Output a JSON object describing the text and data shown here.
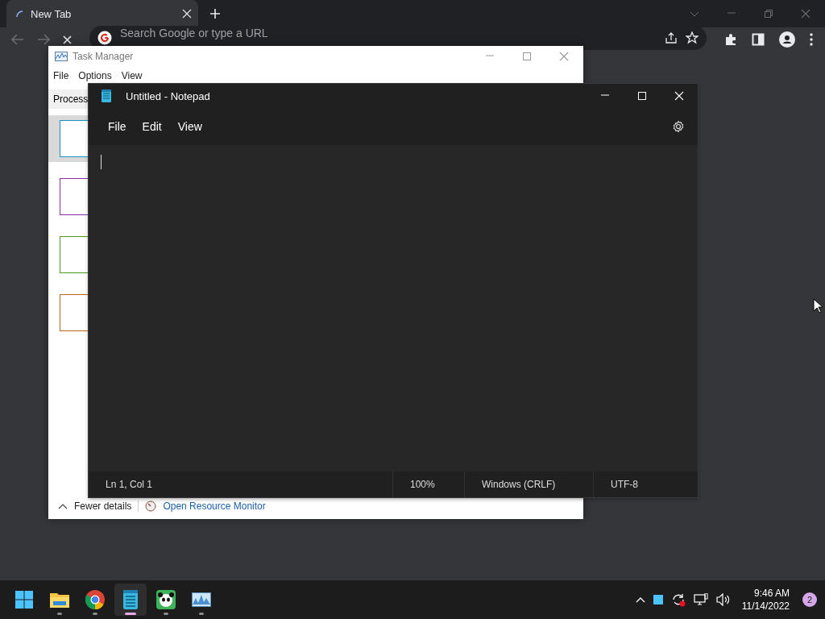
{
  "browser": {
    "tabs": [
      {
        "title": "New Tab",
        "selected": true
      }
    ],
    "omnibox": {
      "placeholder": "Search Google or type a URL"
    }
  },
  "task_manager": {
    "title": "Task Manager",
    "menu": [
      "File",
      "Options",
      "View"
    ],
    "tabs": [
      {
        "label": "Process",
        "selected": true
      }
    ],
    "graphs": [
      {
        "color": "#1a8fc4",
        "selected": true
      },
      {
        "color": "#8b2fa8",
        "selected": false
      },
      {
        "color": "#4f9a1c",
        "selected": false
      },
      {
        "color": "#c0661a",
        "selected": false
      }
    ],
    "footer": {
      "toggle": "Fewer details",
      "link": "Open Resource Monitor"
    }
  },
  "notepad": {
    "title": "Untitled - Notepad",
    "menu": [
      "File",
      "Edit",
      "View"
    ],
    "status": [
      "Ln 1, Col 1",
      "100%",
      "Windows (CRLF)",
      "UTF-8"
    ]
  },
  "taskbar": {
    "apps": [
      {
        "kind": "start",
        "running": false,
        "active": false
      },
      {
        "kind": "folder",
        "running": true,
        "active": false
      },
      {
        "kind": "browser",
        "running": true,
        "active": false
      },
      {
        "kind": "notepad",
        "running": true,
        "active": true
      },
      {
        "kind": "panda",
        "running": true,
        "active": false
      },
      {
        "kind": "monitor",
        "running": true,
        "active": false
      }
    ],
    "clock": {
      "time": "9:46 AM",
      "date": "11/14/2022"
    },
    "notifications": "2"
  }
}
